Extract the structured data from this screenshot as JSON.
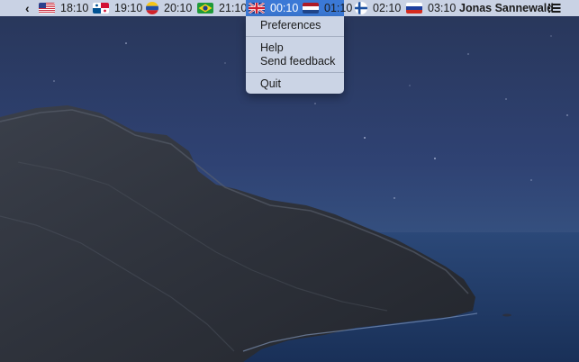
{
  "menubar": {
    "back_chevron": "‹",
    "timezones": [
      {
        "flag": "us-flag",
        "time": "18:10",
        "active": false
      },
      {
        "flag": "panama-flag",
        "time": "19:10",
        "active": false
      },
      {
        "flag": "venezuela-flag",
        "time": "20:10",
        "active": false
      },
      {
        "flag": "brazil-flag",
        "time": "21:10",
        "active": false
      },
      {
        "flag": "uk-flag",
        "time": "00:10",
        "active": true
      },
      {
        "flag": "netherlands-flag",
        "time": "01:10",
        "active": false
      },
      {
        "flag": "finland-flag",
        "time": "02:10",
        "active": false
      },
      {
        "flag": "russia-flag",
        "time": "03:10",
        "active": false
      }
    ],
    "user_name": "Jonas Sannewald",
    "menu_icon": "list-icon"
  },
  "dropdown": {
    "items": [
      "Preferences",
      "Help",
      "Send feedback",
      "Quit"
    ]
  },
  "colors": {
    "menubar_bg": "#d7dff0",
    "active_highlight": "#3b79d6",
    "sky_dark": "#2b3a63",
    "sea": "#1e3560"
  }
}
